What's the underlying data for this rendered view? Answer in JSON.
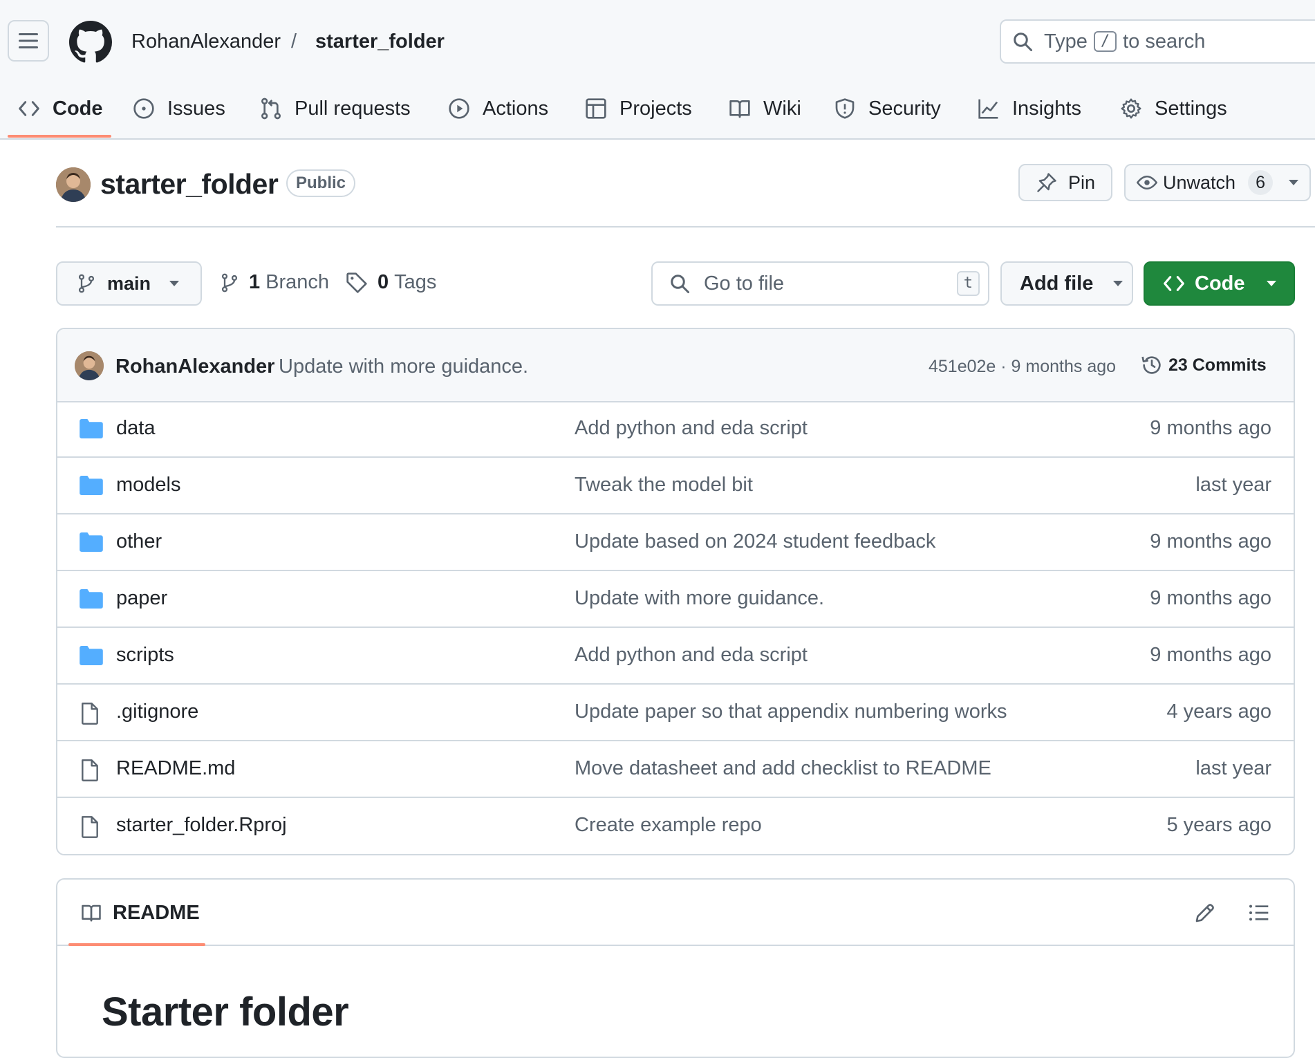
{
  "header": {
    "owner": "RohanAlexander",
    "separator": "/",
    "repo": "starter_folder",
    "search": {
      "prefix": "Type",
      "key": "/",
      "suffix": "to search"
    }
  },
  "nav_tabs": [
    {
      "label": "Code",
      "icon": "code-icon",
      "active": true
    },
    {
      "label": "Issues",
      "icon": "issue-opened-icon"
    },
    {
      "label": "Pull requests",
      "icon": "git-pull-request-icon"
    },
    {
      "label": "Actions",
      "icon": "play-icon"
    },
    {
      "label": "Projects",
      "icon": "table-icon"
    },
    {
      "label": "Wiki",
      "icon": "book-icon"
    },
    {
      "label": "Security",
      "icon": "shield-icon"
    },
    {
      "label": "Insights",
      "icon": "graph-icon"
    },
    {
      "label": "Settings",
      "icon": "gear-icon"
    }
  ],
  "repo": {
    "name": "starter_folder",
    "visibility": "Public",
    "pin_label": "Pin",
    "unwatch_label": "Unwatch",
    "watch_count": "6"
  },
  "toolbar": {
    "branch": "main",
    "branch_count": "1",
    "branch_label": "Branch",
    "tag_count": "0",
    "tag_label": "Tags",
    "go_to_file_placeholder": "Go to file",
    "go_to_file_key": "t",
    "add_file_label": "Add file",
    "code_label": "Code"
  },
  "latest_commit": {
    "author": "RohanAlexander",
    "message": "Update with more guidance.",
    "hash_time": "451e02e · 9 months ago",
    "commits_label": "23 Commits"
  },
  "files": [
    {
      "name": "data",
      "type": "folder",
      "message": "Add python and eda script",
      "time": "9 months ago"
    },
    {
      "name": "models",
      "type": "folder",
      "message": "Tweak the model bit",
      "time": "last year"
    },
    {
      "name": "other",
      "type": "folder",
      "message": "Update based on 2024 student feedback",
      "time": "9 months ago"
    },
    {
      "name": "paper",
      "type": "folder",
      "message": "Update with more guidance.",
      "time": "9 months ago"
    },
    {
      "name": "scripts",
      "type": "folder",
      "message": "Add python and eda script",
      "time": "9 months ago"
    },
    {
      "name": ".gitignore",
      "type": "file",
      "message": "Update paper so that appendix numbering works",
      "time": "4 years ago"
    },
    {
      "name": "README.md",
      "type": "file",
      "message": "Move datasheet and add checklist to README",
      "time": "last year"
    },
    {
      "name": "starter_folder.Rproj",
      "type": "file",
      "message": "Create example repo",
      "time": "5 years ago"
    }
  ],
  "readme": {
    "tab_label": "README",
    "heading": "Starter folder"
  },
  "colors": {
    "accent_underline": "#fd8c73",
    "primary_button": "#1f883d",
    "folder": "#54aeff",
    "muted_text": "#59636e",
    "border": "#d1d9e0"
  }
}
